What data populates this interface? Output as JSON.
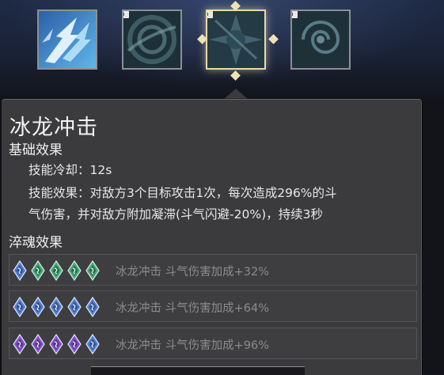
{
  "skill_slots": [
    {
      "name": "ice-dragon-strike",
      "locked": false,
      "active": false
    },
    {
      "name": "skill-2",
      "locked": true,
      "active": false
    },
    {
      "name": "skill-3",
      "locked": true,
      "active": true
    },
    {
      "name": "skill-4",
      "locked": true,
      "active": false
    }
  ],
  "tooltip": {
    "title": "冰龙冲击",
    "base_effect_heading": "基础效果",
    "cooldown": "技能冷却：12s",
    "effect_line1": "技能效果：对敌方3个目标攻击1次，每次造成296%的斗",
    "effect_line2": "气伤害，并对敌方附加凝滞(斗气闪避-20%)，持续3秒",
    "soul_heading": "淬魂效果",
    "tiers": [
      {
        "gems": [
          "blue",
          "green",
          "green",
          "green",
          "green"
        ],
        "text": "冰龙冲击 斗气伤害加成+32%"
      },
      {
        "gems": [
          "blue",
          "blue",
          "blue",
          "blue",
          "blue"
        ],
        "text": "冰龙冲击 斗气伤害加成+64%"
      },
      {
        "gems": [
          "purple",
          "purple",
          "purple",
          "purple",
          "blue"
        ],
        "text": "冰龙冲击 斗气伤害加成+96%"
      }
    ]
  },
  "colors": {
    "panel": "#3b3b3e",
    "active_border": "#e9d9a8",
    "gem_blue": "#4f7fd9",
    "gem_green": "#3fb06a",
    "gem_purple": "#8a4fd0"
  }
}
